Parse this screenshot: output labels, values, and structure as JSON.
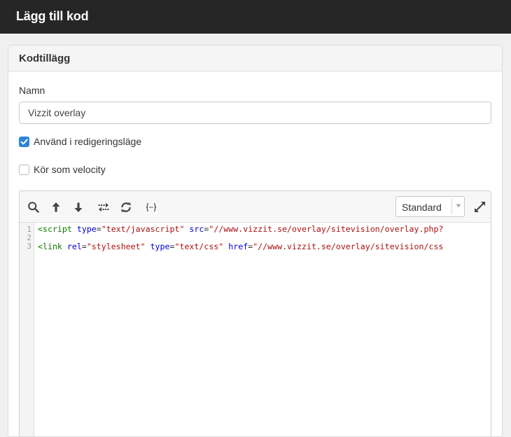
{
  "window": {
    "title": "Lägg till kod"
  },
  "panel": {
    "heading": "Kodtillägg"
  },
  "form": {
    "name_label": "Namn",
    "name_value": "Vizzit overlay",
    "use_in_edit_mode": {
      "label": "Använd i redigeringsläge",
      "checked": true
    },
    "run_as_velocity": {
      "label": "Kör som velocity",
      "checked": false
    }
  },
  "editor": {
    "toolbar": {
      "icons": [
        "search-icon",
        "arrow-up-icon",
        "arrow-down-icon",
        "replace-icon",
        "refresh-icon",
        "format-braces-icon",
        "expand-icon"
      ],
      "mode_select": {
        "selected": "Standard"
      }
    },
    "line_numbers": [
      "1",
      "2",
      "3"
    ],
    "lines": [
      [
        {
          "t": "tag",
          "v": "<script"
        },
        {
          "t": "plain",
          "v": " "
        },
        {
          "t": "attr",
          "v": "type"
        },
        {
          "t": "plain",
          "v": "="
        },
        {
          "t": "str",
          "v": "\"text/javascript\""
        },
        {
          "t": "plain",
          "v": " "
        },
        {
          "t": "attr",
          "v": "src"
        },
        {
          "t": "plain",
          "v": "="
        },
        {
          "t": "str",
          "v": "\"//www.vizzit.se/overlay/sitevision/overlay.php?"
        }
      ],
      [],
      [
        {
          "t": "tag",
          "v": "<link"
        },
        {
          "t": "plain",
          "v": " "
        },
        {
          "t": "attr",
          "v": "rel"
        },
        {
          "t": "plain",
          "v": "="
        },
        {
          "t": "str",
          "v": "\"stylesheet\""
        },
        {
          "t": "plain",
          "v": " "
        },
        {
          "t": "attr",
          "v": "type"
        },
        {
          "t": "plain",
          "v": "="
        },
        {
          "t": "str",
          "v": "\"text/css\""
        },
        {
          "t": "plain",
          "v": " "
        },
        {
          "t": "attr",
          "v": "href"
        },
        {
          "t": "plain",
          "v": "="
        },
        {
          "t": "str",
          "v": "\"//www.vizzit.se/overlay/sitevision/css"
        }
      ]
    ]
  },
  "colors": {
    "accent": "#2c84d8",
    "titlebar": "#262626"
  }
}
